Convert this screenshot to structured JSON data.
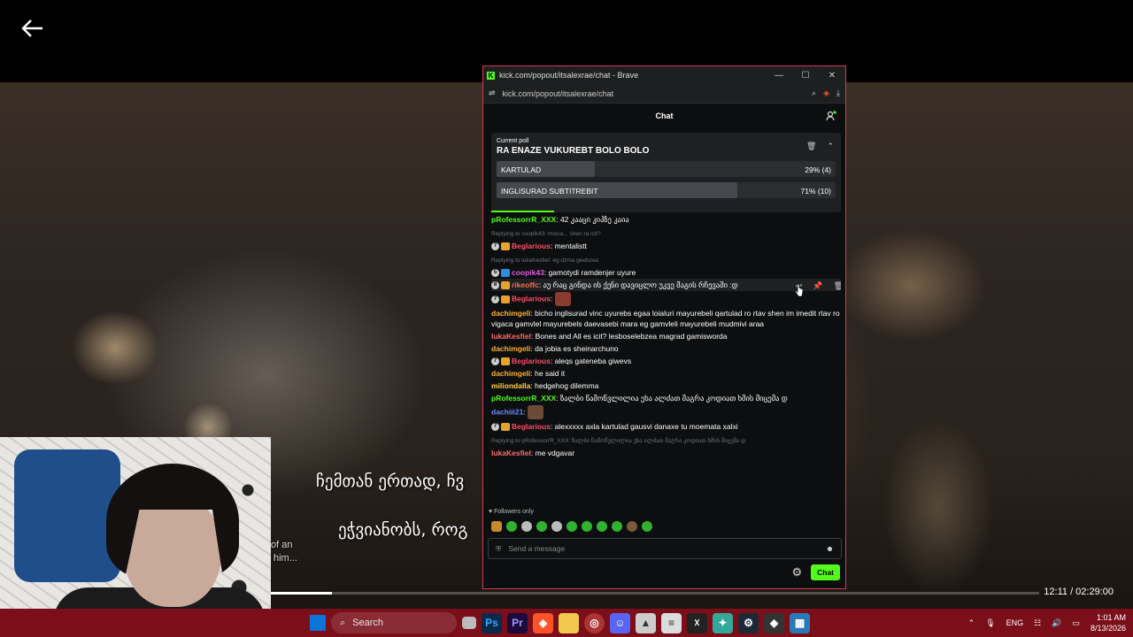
{
  "player": {
    "subtitle_line1": "ჩემთან ერთად, ჩვ",
    "subtitle_line2": "ეჭვიანობს, როგ",
    "subtitle_en1": "of an",
    "subtitle_en2": "him...",
    "time": "12:11 / 02:29:00",
    "progress_fraction": 0.08
  },
  "browser": {
    "title": "kick.com/popout/itsalexrae/chat - Brave",
    "url": "kick.com/popout/itsalexrae/chat"
  },
  "chat": {
    "header": "Chat",
    "poll": {
      "label": "Current poll",
      "question": "RA ENAZE VUKUREBT BOLO BOLO",
      "options": [
        {
          "name": "KARTULAD",
          "result": "29% (4)",
          "fraction": 0.29
        },
        {
          "name": "INGLISURAD SUBTITREBIT",
          "result": "71% (10)",
          "fraction": 0.71
        }
      ],
      "timer_fraction": 0.18
    },
    "messages": [
      {
        "user": "pRofessorrR_XXX",
        "text": ": 42 კააცი კიპზე კაია"
      },
      {
        "reply": "Replying to coopik43: moica... shen ra icit?"
      },
      {
        "user": "Beglarious",
        "text": ": mentalistt"
      },
      {
        "reply": "Replying to lukaKesfiel: eg dzma geebzea"
      },
      {
        "user": "coopik43",
        "text": ": gamotydi ramdenjer uyure"
      },
      {
        "user": "rikeoffc",
        "text": ": აუ რაც გინდა ის ქენი დავიცლო უკვე მაგის რჩევაში :დ"
      },
      {
        "user": "Beglarious",
        "text": ":"
      },
      {
        "user": "dachimgeli",
        "text": ": bicho inglisurad vinc uyurebs egaa loialuri mayurebeli qartulad ro rtav shen im imedit rtav ro vigaca gamvlel mayurebels daevasebi mara eg gamvleli mayurebeli mudmivi araa"
      },
      {
        "user": "lukaKesfiel",
        "text": ": Bones and All es icit? lesboselebzea magrad gamisworda"
      },
      {
        "user": "dachimgeli",
        "text": ": da jobia es sheinarchuno"
      },
      {
        "user": "Beglarious",
        "text": ": aleqs gateneba giwevs"
      },
      {
        "user": "dachimgeli",
        "text": ": he said it"
      },
      {
        "user": "miliondalla",
        "text": ": hedgehog dilemma"
      },
      {
        "user": "pRofessorrR_XXX",
        "text": ": ზალბი წამოწვლილია ეხა ალძათ მაგრა კოდიათ ხმის მიცემა დ"
      },
      {
        "user": "dachiii21",
        "text": ":"
      },
      {
        "user": "Beglarious",
        "text": ": alexxxxx axla kartulad gausvi danaxe tu moemata xalxi"
      },
      {
        "reply": "Replying to pRofessorrR_XXX: ზალბი წამოწვლილია ეხა ალძათ მაგრა კოდიათ ხმის მიცემა დ"
      },
      {
        "user": "lukaKesfiel",
        "text": ": me vdgavar"
      }
    ],
    "followers_only": "Followers only",
    "input_placeholder": "Send a message",
    "chat_button": "Chat"
  },
  "taskbar": {
    "search": "Search",
    "lang": "ENG",
    "time": "1:01 AM",
    "date": "8/13/2026"
  },
  "colors": {
    "kick_green": "#53fc18",
    "taskbar": "#7a0f1a",
    "popup_border": "#d23b53"
  }
}
